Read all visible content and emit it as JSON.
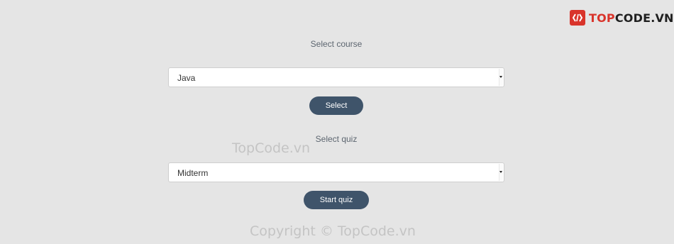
{
  "brand": {
    "prefix": "TOP",
    "suffix": "CODE.VN"
  },
  "course": {
    "heading": "Select course",
    "selected": "Java",
    "button": "Select"
  },
  "quiz": {
    "heading": "Select quiz",
    "selected": "Midterm",
    "button": "Start quiz"
  },
  "watermarks": {
    "middle": "TopCode.vn",
    "footer": "Copyright © TopCode.vn"
  },
  "colors": {
    "button": "#3f546a",
    "background": "#e5e5e5",
    "brand_red": "#d9342b"
  }
}
